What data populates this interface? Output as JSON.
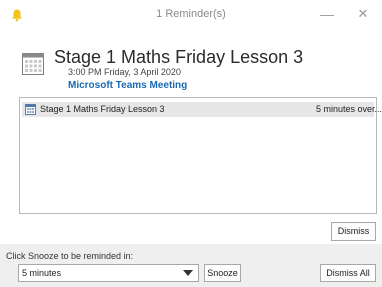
{
  "window": {
    "title": "1 Reminder(s)",
    "minimize_glyph": "—",
    "close_glyph": "✕"
  },
  "event": {
    "title": "Stage 1 Maths Friday Lesson 3",
    "time": "3:00 PM Friday, 3 April 2020",
    "location_link": "Microsoft Teams Meeting"
  },
  "reminders": [
    {
      "subject": "Stage 1 Maths Friday Lesson 3",
      "due_in": "5 minutes over..."
    }
  ],
  "buttons": {
    "dismiss": "Dismiss",
    "snooze": "Snooze",
    "dismiss_all": "Dismiss All"
  },
  "snooze": {
    "hint": "Click Snooze to be reminded in:",
    "selected": "5 minutes"
  },
  "colors": {
    "accent_link": "#1a6ab3",
    "bell": "#f0c419",
    "bottom_bar": "#efefef"
  },
  "icons": [
    "bell-icon",
    "calendar-icon",
    "minimize-icon",
    "close-icon",
    "dropdown-arrow-icon"
  ]
}
